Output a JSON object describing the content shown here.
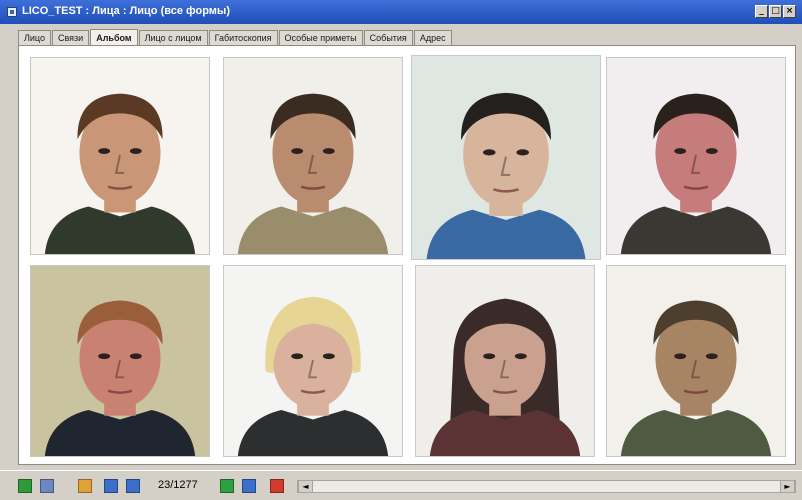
{
  "window": {
    "title": "LICO_TEST : Лица : Лицо (все формы)",
    "controls": [
      "_",
      "□",
      "×"
    ]
  },
  "tabs": [
    {
      "label": "Лицо",
      "active": false
    },
    {
      "label": "Связи",
      "active": false
    },
    {
      "label": "Альбом",
      "active": true
    },
    {
      "label": "Лицо с лицом",
      "active": false
    },
    {
      "label": "Габитоскопия",
      "active": false
    },
    {
      "label": "Особые приметы",
      "active": false
    },
    {
      "label": "События",
      "active": false
    },
    {
      "label": "Адрес",
      "active": false
    }
  ],
  "album": {
    "photos": [
      {
        "id": "photo-1",
        "bg": "#f7f4ef",
        "skin": "#c99678",
        "hair": "#5a3a24",
        "clothes": "#2f3a2d",
        "hair_style": "short",
        "selected": false
      },
      {
        "id": "photo-2",
        "bg": "#f1efe9",
        "skin": "#b98b6f",
        "hair": "#3b2c22",
        "clothes": "#9a8d6c",
        "hair_style": "short",
        "selected": false
      },
      {
        "id": "photo-3",
        "bg": "#dfe7e3",
        "skin": "#d7b59d",
        "hair": "#24201d",
        "clothes": "#3a6aa3",
        "hair_style": "short",
        "selected": true
      },
      {
        "id": "photo-4",
        "bg": "#f2eef0",
        "skin": "#c67c7a",
        "hair": "#2b211c",
        "clothes": "#3b3833",
        "hair_style": "short",
        "selected": false
      },
      {
        "id": "photo-5",
        "bg": "#c9c3a0",
        "skin": "#c98272",
        "hair": "#9a5e3a",
        "clothes": "#1f2630",
        "hair_style": "short",
        "selected": false
      },
      {
        "id": "photo-6",
        "bg": "#f4f4f2",
        "skin": "#d9b19c",
        "hair": "#e7d596",
        "clothes": "#2d2e2f",
        "hair_style": "bob",
        "selected": false
      },
      {
        "id": "photo-7",
        "bg": "#efeeea",
        "skin": "#caa08e",
        "hair": "#3a2b28",
        "clothes": "#5b3335",
        "hair_style": "long",
        "selected": false
      },
      {
        "id": "photo-8",
        "bg": "#f2f0ea",
        "skin": "#a78464",
        "hair": "#4d3f2c",
        "clothes": "#4e5a42",
        "hair_style": "short",
        "selected": false
      }
    ]
  },
  "statusbar": {
    "counter": "23/1277",
    "icons": [
      {
        "name": "refresh-icon",
        "color": "#2e9a3a"
      },
      {
        "name": "tools-icon",
        "color": "#6c88c0"
      },
      {
        "name": "folder-icon",
        "color": "#e0a33a"
      },
      {
        "name": "first-record-icon",
        "color": "#3a6ec8"
      },
      {
        "name": "prev-record-icon",
        "color": "#3a6ec8"
      },
      {
        "name": "next-record-icon",
        "color": "#2ea042"
      },
      {
        "name": "last-record-icon",
        "color": "#3a6ec8"
      },
      {
        "name": "delete-record-icon",
        "color": "#d23a2c"
      }
    ],
    "scroll_left": "◄",
    "scroll_right": "►"
  }
}
